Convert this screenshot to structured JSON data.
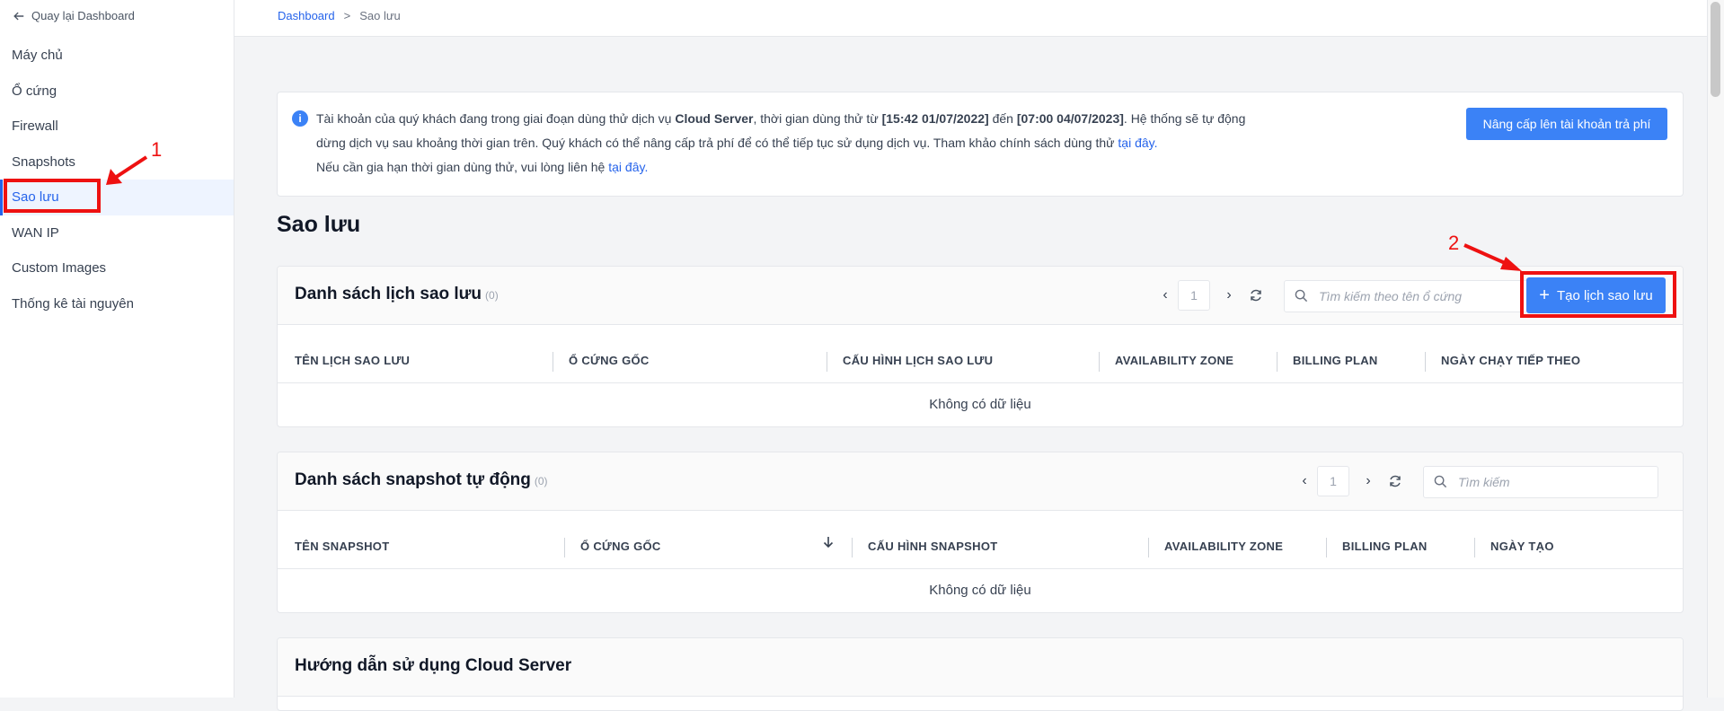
{
  "sidebar": {
    "back_label": "Quay lại Dashboard",
    "items": [
      {
        "label": "Máy chủ"
      },
      {
        "label": "Ổ cứng"
      },
      {
        "label": "Firewall"
      },
      {
        "label": "Snapshots"
      },
      {
        "label": "Sao lưu",
        "active": true
      },
      {
        "label": "WAN IP"
      },
      {
        "label": "Custom Images"
      },
      {
        "label": "Thống kê tài nguyên"
      }
    ]
  },
  "breadcrumb": {
    "root": "Dashboard",
    "separator": ">",
    "current": "Sao lưu"
  },
  "notice": {
    "line1_a": "Tài khoản của quý khách đang trong giai đoạn dùng thử dịch vụ ",
    "line1_b": "Cloud Server",
    "line1_c": ", thời gian dùng thử từ ",
    "line1_d": "[15:42 01/07/2022]",
    "line1_e": " đến ",
    "line1_f": "[07:00 04/07/2023]",
    "line1_g": ". Hệ thống sẽ tự động",
    "line2": "dừng dịch vụ sau khoảng thời gian trên. Quý khách có thể nâng cấp trả phí để có thể tiếp tục sử dụng dịch vụ. Tham khảo chính sách dùng thử ",
    "link": "tại đây.",
    "line3": "Nếu cần gia hạn thời gian dùng thử, vui lòng liên hệ ",
    "upgrade_label": "Nâng cấp lên tài khoản trả phí"
  },
  "page_title": "Sao lưu",
  "backup_panel": {
    "title": "Danh sách lịch sao lưu",
    "count": "(0)",
    "page": "1",
    "search_placeholder": "Tìm kiếm theo tên ổ cứng",
    "create_label": "Tạo lịch sao lưu",
    "columns": [
      "TÊN LỊCH SAO LƯU",
      "Ổ CỨNG GỐC",
      "CẤU HÌNH LỊCH SAO LƯU",
      "AVAILABILITY ZONE",
      "BILLING PLAN",
      "NGÀY CHẠY TIẾP THEO"
    ],
    "empty": "Không có dữ liệu"
  },
  "snapshot_panel": {
    "title": "Danh sách snapshot tự động",
    "count": "(0)",
    "page": "1",
    "search_placeholder": "Tìm kiếm",
    "columns": [
      "TÊN SNAPSHOT",
      "Ổ CỨNG GỐC",
      "CẤU HÌNH SNAPSHOT",
      "AVAILABILITY ZONE",
      "BILLING PLAN",
      "NGÀY TẠO"
    ],
    "empty": "Không có dữ liệu"
  },
  "guide_panel": {
    "title": "Hướng dẫn sử dụng Cloud Server"
  },
  "annotations": {
    "first": "1",
    "second": "2",
    "color": "#ee1111"
  },
  "colors": {
    "accent": "#3b82f6",
    "link": "#2563eb"
  }
}
